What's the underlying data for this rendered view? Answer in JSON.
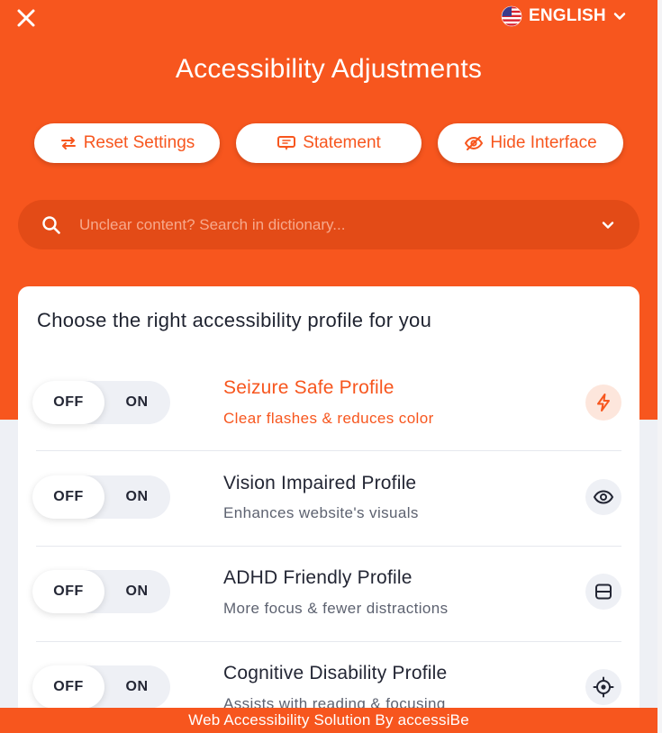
{
  "header": {
    "language": "ENGLISH",
    "title": "Accessibility Adjustments"
  },
  "actions": {
    "reset_label": "Reset Settings",
    "statement_label": "Statement",
    "hide_label": "Hide Interface"
  },
  "search": {
    "placeholder": "Unclear content? Search in dictionary..."
  },
  "profiles": {
    "heading": "Choose the right accessibility profile for you",
    "items": [
      {
        "name": "Seizure Safe Profile",
        "description": "Clear flashes & reduces color",
        "off_label": "OFF",
        "on_label": "ON",
        "icon": "lightning-icon",
        "state": "OFF"
      },
      {
        "name": "Vision Impaired Profile",
        "description": "Enhances website's visuals",
        "off_label": "OFF",
        "on_label": "ON",
        "icon": "eye-icon",
        "state": "OFF"
      },
      {
        "name": "ADHD Friendly Profile",
        "description": "More focus & fewer distractions",
        "off_label": "OFF",
        "on_label": "ON",
        "icon": "focus-frame-icon",
        "state": "OFF"
      },
      {
        "name": "Cognitive Disability Profile",
        "description": "Assists with reading & focusing",
        "off_label": "OFF",
        "on_label": "ON",
        "icon": "target-icon",
        "state": "OFF"
      }
    ]
  },
  "footer": {
    "text": "Web Accessibility Solution By accessiBe"
  },
  "colors": {
    "accent": "#f7561e",
    "text_dark": "#232634",
    "background": "#eef0f5"
  }
}
